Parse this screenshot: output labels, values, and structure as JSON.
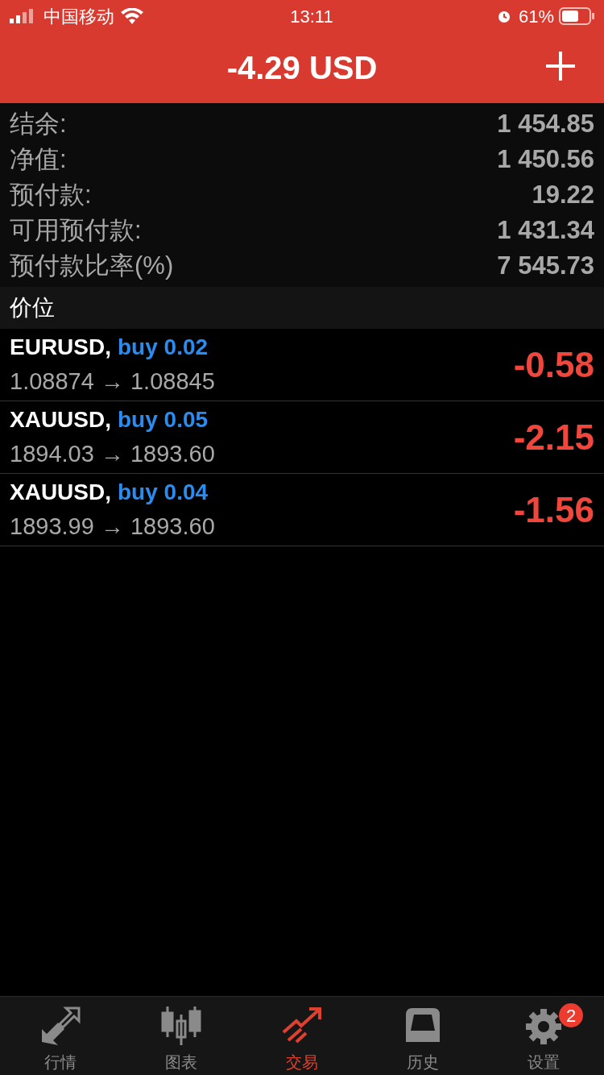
{
  "status_bar": {
    "carrier": "中国移动",
    "time": "13:11",
    "battery": "61%"
  },
  "header": {
    "title": "-4.29 USD"
  },
  "summary": [
    {
      "label": "结余:",
      "value": "1 454.85"
    },
    {
      "label": "净值:",
      "value": "1 450.56"
    },
    {
      "label": "预付款:",
      "value": "19.22"
    },
    {
      "label": "可用预付款:",
      "value": "1 431.34"
    },
    {
      "label": "预付款比率(%)",
      "value": "7 545.73"
    }
  ],
  "section": {
    "title": "价位"
  },
  "positions": [
    {
      "symbol": "EURUSD,",
      "order": "buy 0.02",
      "prices": "1.08874 → 1.08845",
      "profit": "-0.58"
    },
    {
      "symbol": "XAUUSD,",
      "order": "buy 0.05",
      "prices": "1894.03 → 1893.60",
      "profit": "-2.15"
    },
    {
      "symbol": "XAUUSD,",
      "order": "buy 0.04",
      "prices": "1893.99 → 1893.60",
      "profit": "-1.56"
    }
  ],
  "tabs": [
    {
      "kind": "quotes",
      "label": "行情",
      "selected": false
    },
    {
      "kind": "chart",
      "label": "图表",
      "selected": false
    },
    {
      "kind": "trade",
      "label": "交易",
      "selected": true
    },
    {
      "kind": "history",
      "label": "历史",
      "selected": false
    },
    {
      "kind": "settings",
      "label": "设置",
      "selected": false,
      "badge": "2"
    }
  ]
}
